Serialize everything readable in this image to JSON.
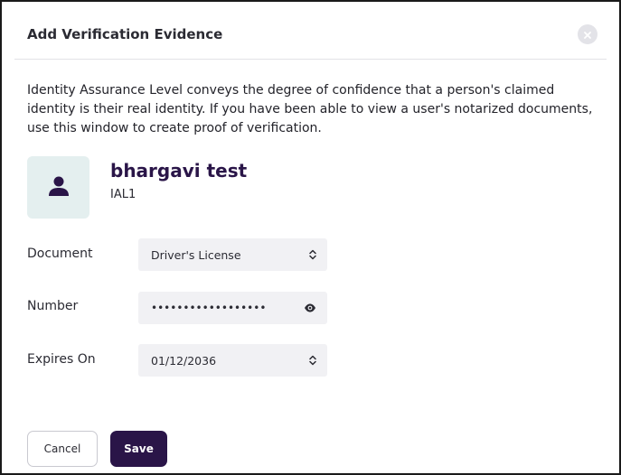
{
  "dialog": {
    "title": "Add Verification Evidence",
    "description": "Identity Assurance Level conveys the degree of confidence that a person's claimed identity is their real identity. If you have been able to view a user's notarized documents, use this window to create proof of verification."
  },
  "user": {
    "name": "bhargavi test",
    "level": "IAL1"
  },
  "form": {
    "document_label": "Document",
    "document_value": "Driver's License",
    "number_label": "Number",
    "number_value": "••••••••••••••••••",
    "expires_label": "Expires On",
    "expires_value": "01/12/2036"
  },
  "actions": {
    "cancel_label": "Cancel",
    "save_label": "Save"
  },
  "icons": {
    "close": "close-icon",
    "avatar": "person-icon",
    "select_arrows": "updown-chevron-icon",
    "reveal": "eye-icon"
  },
  "colors": {
    "brand": "#2a1548",
    "avatar_bg": "#e4efef",
    "field_bg": "#f1f1f4"
  }
}
